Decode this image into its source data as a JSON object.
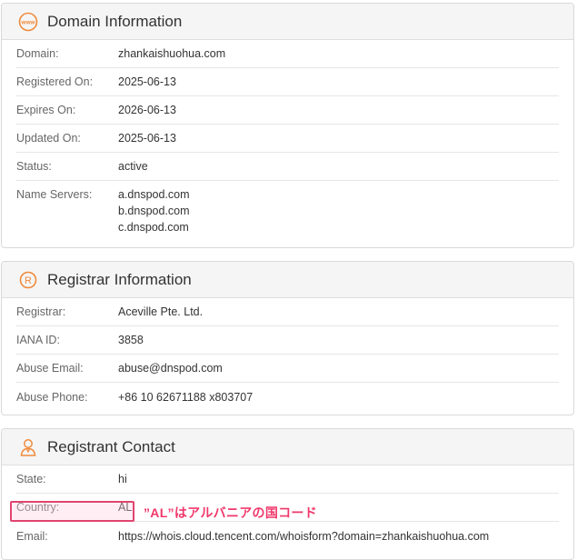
{
  "domain_info": {
    "title": "Domain Information",
    "icon": "www-icon",
    "rows": [
      {
        "label": "Domain:",
        "value": "zhankaishuohua.com"
      },
      {
        "label": "Registered On:",
        "value": "2025-06-13"
      },
      {
        "label": "Expires On:",
        "value": "2026-06-13"
      },
      {
        "label": "Updated On:",
        "value": "2025-06-13"
      },
      {
        "label": "Status:",
        "value": "active"
      }
    ],
    "name_servers": {
      "label": "Name Servers:",
      "values": [
        "a.dnspod.com",
        "b.dnspod.com",
        "c.dnspod.com"
      ]
    }
  },
  "registrar_info": {
    "title": "Registrar Information",
    "icon": "registered-icon",
    "rows": [
      {
        "label": "Registrar:",
        "value": "Aceville Pte. Ltd."
      },
      {
        "label": "IANA ID:",
        "value": "3858"
      },
      {
        "label": "Abuse Email:",
        "value": "abuse@dnspod.com"
      },
      {
        "label": "Abuse Phone:",
        "value": "+86 10 62671188 x803707"
      }
    ]
  },
  "registrant_contact": {
    "title": "Registrant Contact",
    "icon": "person-icon",
    "rows": [
      {
        "label": "State:",
        "value": "hi"
      },
      {
        "label": "Country:",
        "value": "AL"
      },
      {
        "label": "Email:",
        "value": "https://whois.cloud.tencent.com/whoisform?domain=zhankaishuohua.com"
      }
    ]
  },
  "annotation": {
    "text": "”AL”はアルバニアの国コード"
  },
  "colors": {
    "accent_icon": "#f08a3c",
    "annotation": "#f0386b"
  }
}
